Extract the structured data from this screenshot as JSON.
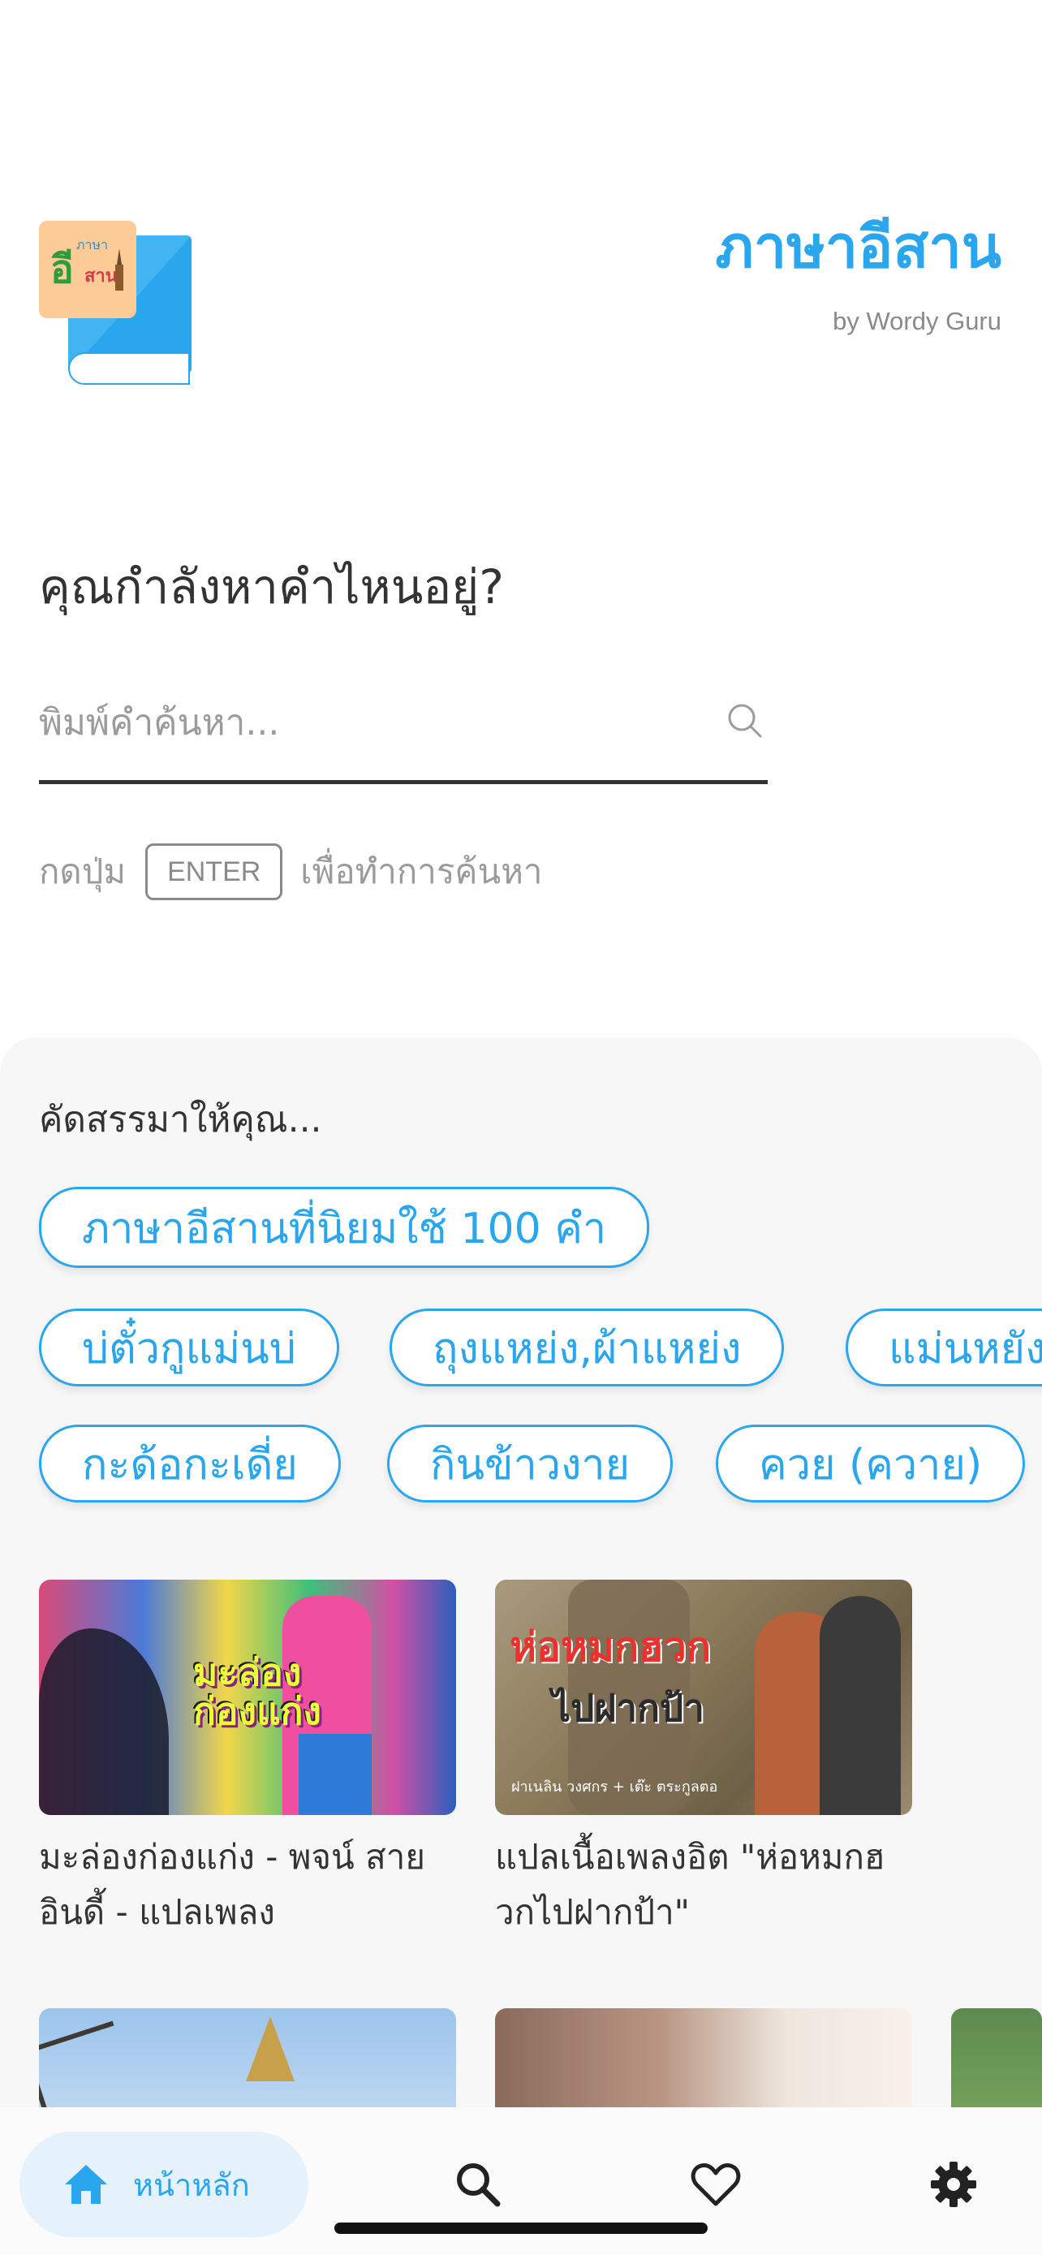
{
  "header": {
    "logo_badge_top": "ภาษา",
    "logo_badge_main": "อี",
    "logo_badge_side": "สาน",
    "title": "ภาษาอีสาน",
    "subtitle": "by Wordy Guru"
  },
  "search": {
    "question": "คุณกำลังหาคำไหนอยู่?",
    "placeholder": "พิมพ์คำค้นหา...",
    "value": "",
    "hint_before": "กดปุ่ม",
    "hint_key": "ENTER",
    "hint_after": "เพื่อทำการค้นหา"
  },
  "recommend": {
    "title": "คัดสรรมาให้คุณ...",
    "featured_chip": "ภาษาอีสานที่นิยมใช้ 100 คำ",
    "chips_row1": [
      "บ่ตั๋วกูแม่นบ่",
      "ถุงแหย่ง,ผ้าแหย่ง",
      "แม่นหยัง"
    ],
    "chips_row2": [
      "กะด้อกะเดี่ย",
      "กินข้าวงาย",
      "ควย (ควาย)"
    ]
  },
  "articles": [
    {
      "caption": "มะล่องก่องแก่ง - พจน์ สาย อินดี้ - แปลเพลง",
      "thumb_text": "มะล่อง\nก่องแก่ง"
    },
    {
      "caption": "แปลเนื้อเพลงอิต \"ห่อหมกฮวกไปฝากป้า\"",
      "thumb_text": "ห่อหมกฮวก",
      "thumb_text2": "ไปฝากป้า",
      "thumb_credit": "ฝาเนลิน วงศกร + เต๊ะ ตระกูลตอ"
    }
  ],
  "nav": {
    "home_label": "หน้าหลัก",
    "active": "home",
    "home_icon": "home-icon",
    "search_icon": "search-icon",
    "favorites_icon": "heart-icon",
    "settings_icon": "gear-icon"
  },
  "colors": {
    "accent": "#2aa6ee",
    "text": "#333333",
    "muted": "#9b9b9b",
    "panel_bg": "#f7f7f8",
    "nav_active_bg": "#e5f2fc"
  }
}
